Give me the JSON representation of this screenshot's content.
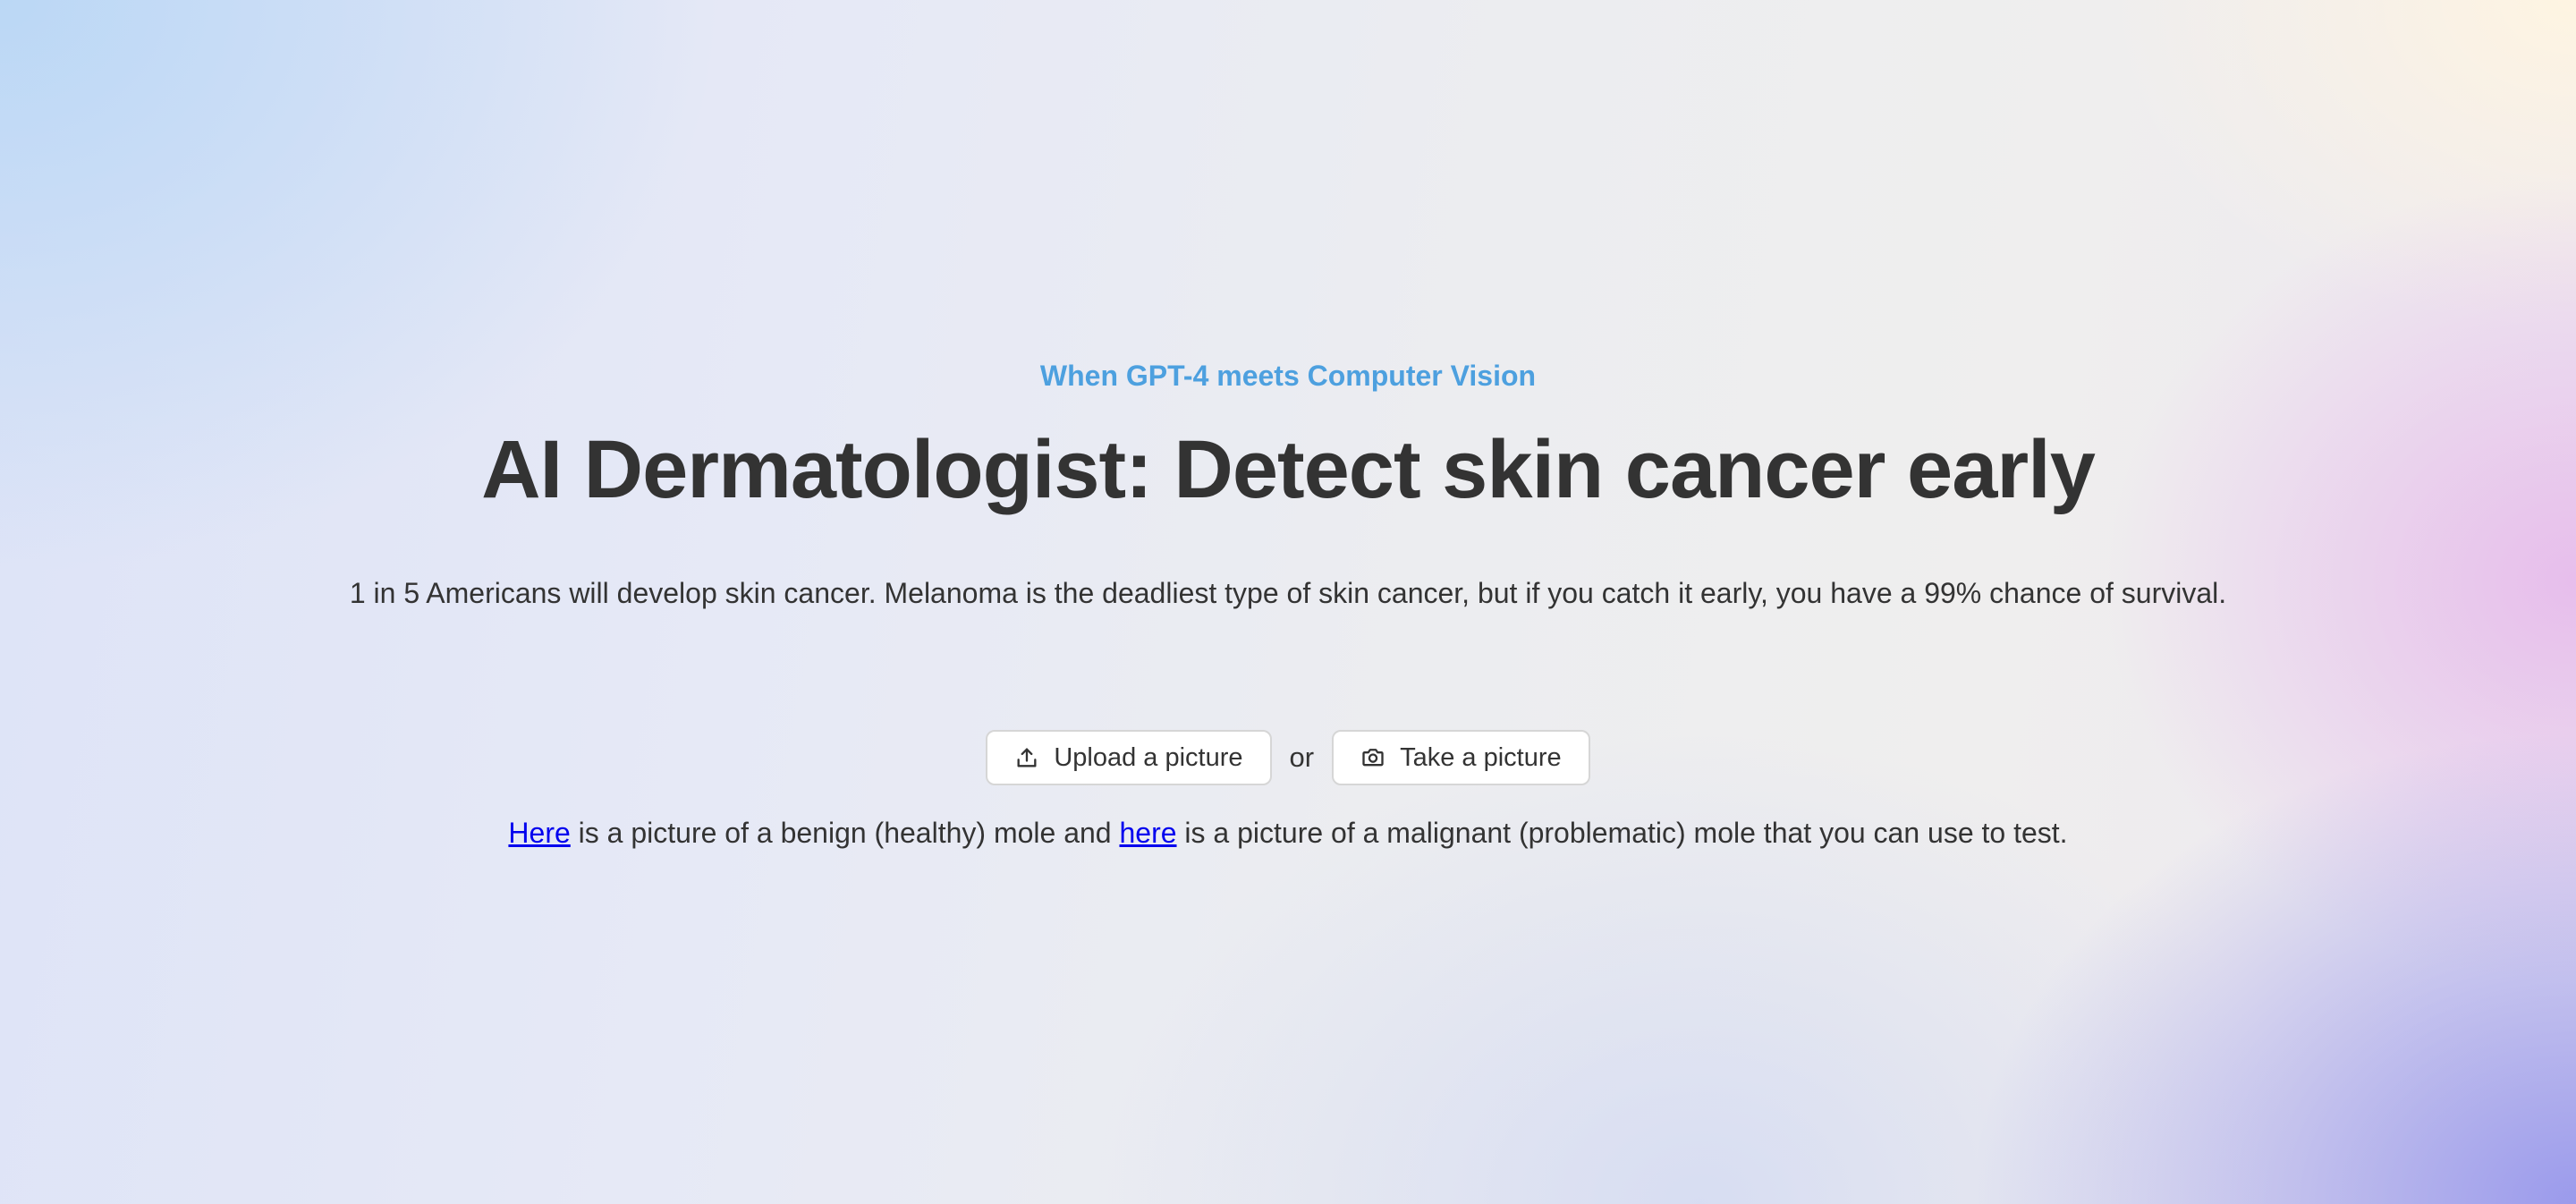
{
  "hero": {
    "eyebrow": "When GPT-4 meets Computer Vision",
    "title": "AI Dermatologist: Detect skin cancer early",
    "subtitle": "1 in 5 Americans will develop skin cancer. Melanoma is the deadliest type of skin cancer, but if you catch it early, you have a 99% chance of survival."
  },
  "actions": {
    "upload_label": "Upload a picture",
    "upload_icon": "upload-icon",
    "or_label": "or",
    "camera_label": "Take a picture",
    "camera_icon": "camera-icon"
  },
  "note": {
    "link1": "Here",
    "text1": " is a picture of a benign (healthy) mole and ",
    "link2": "here",
    "text2": " is a picture of a malignant (problematic) mole that you can use to test."
  },
  "colors": {
    "accent": "#4da0df",
    "text": "#333333",
    "link": "#0000ee"
  }
}
